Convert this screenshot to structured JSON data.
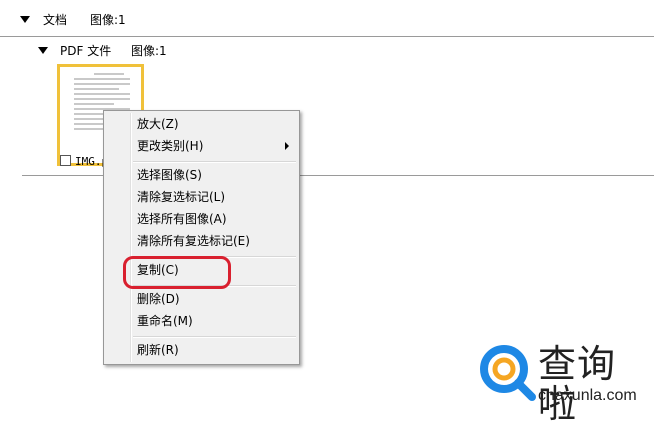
{
  "tree": {
    "root_label": "文档",
    "root_image_count": "图像:1",
    "child_label": "PDF 文件",
    "child_image_count": "图像:1"
  },
  "thumbnail": {
    "filename": "IMG.p",
    "checked": false
  },
  "context_menu": {
    "items": [
      {
        "label": "放大(Z)"
      },
      {
        "label": "更改类别(H)",
        "has_submenu": true
      },
      {
        "label": "选择图像(S)"
      },
      {
        "label": "清除复选标记(L)"
      },
      {
        "label": "选择所有图像(A)"
      },
      {
        "label": "清除所有复选标记(E)"
      },
      {
        "label": "复制(C)",
        "highlighted": true
      },
      {
        "label": "删除(D)"
      },
      {
        "label": "重命名(M)"
      },
      {
        "label": "刷新(R)"
      }
    ]
  },
  "watermark": {
    "text": "查询啦",
    "url": "chaxunla.com",
    "icon": "magnifier-logo-icon",
    "colors": {
      "blue": "#1e88e5",
      "orange": "#f5a623"
    }
  },
  "colors": {
    "selection_border": "#f0c13a",
    "annotation_red": "#d9202f",
    "menu_bg": "#f0f0f0"
  }
}
